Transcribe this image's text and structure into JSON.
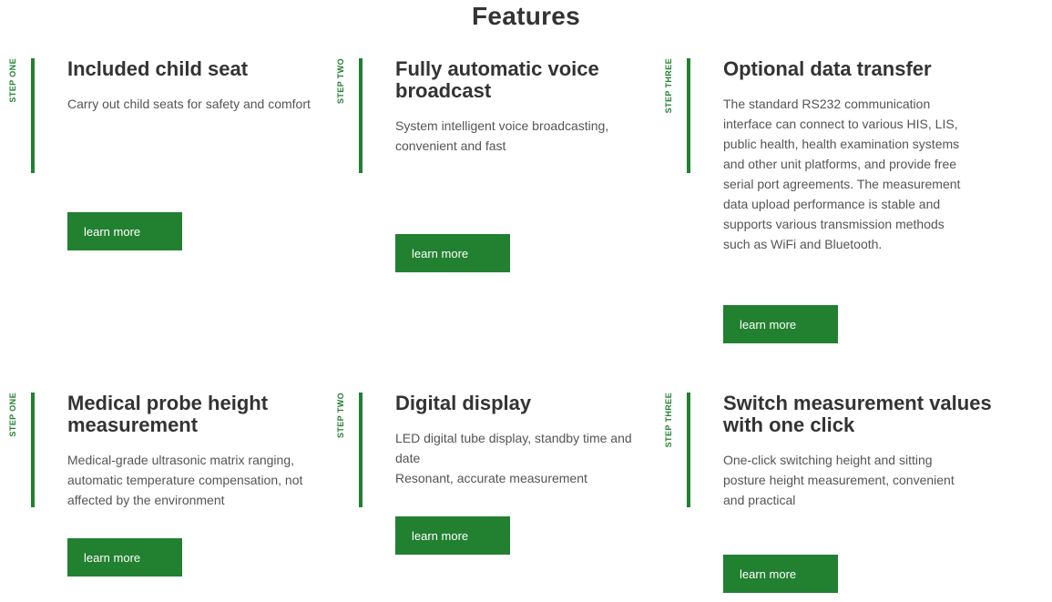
{
  "section": {
    "title": "Features"
  },
  "features": [
    {
      "step": "STEP ONE",
      "title": "Included child seat",
      "description": "Carry out child seats for safety and comfort",
      "button": "learn more"
    },
    {
      "step": "STEP TWO",
      "title": "Fully automatic voice broadcast",
      "description": "System intelligent voice broadcasting, convenient and fast",
      "button": "learn more"
    },
    {
      "step": "STEP THREE",
      "title": "Optional data transfer",
      "description": "The standard RS232 communication interface can connect to various HIS, LIS, public health, health examination systems and other unit platforms, and provide free serial port agreements. The measurement data upload performance is stable and supports various transmission methods such as WiFi and Bluetooth.",
      "button": "learn more"
    },
    {
      "step": "STEP ONE",
      "title": "Medical probe height measurement",
      "description": "Medical-grade ultrasonic matrix ranging, automatic temperature compensation, not affected by the environment",
      "button": "learn more"
    },
    {
      "step": "STEP TWO",
      "title": "Digital display",
      "description": "LED digital tube display, standby time and date\nResonant, accurate measurement",
      "button": "learn more"
    },
    {
      "step": "STEP THREE",
      "title": "Switch measurement values with one click",
      "description": "One-click switching height and sitting posture height measurement, convenient and practical",
      "button": "learn more"
    }
  ],
  "colors": {
    "accent": "#228031"
  }
}
